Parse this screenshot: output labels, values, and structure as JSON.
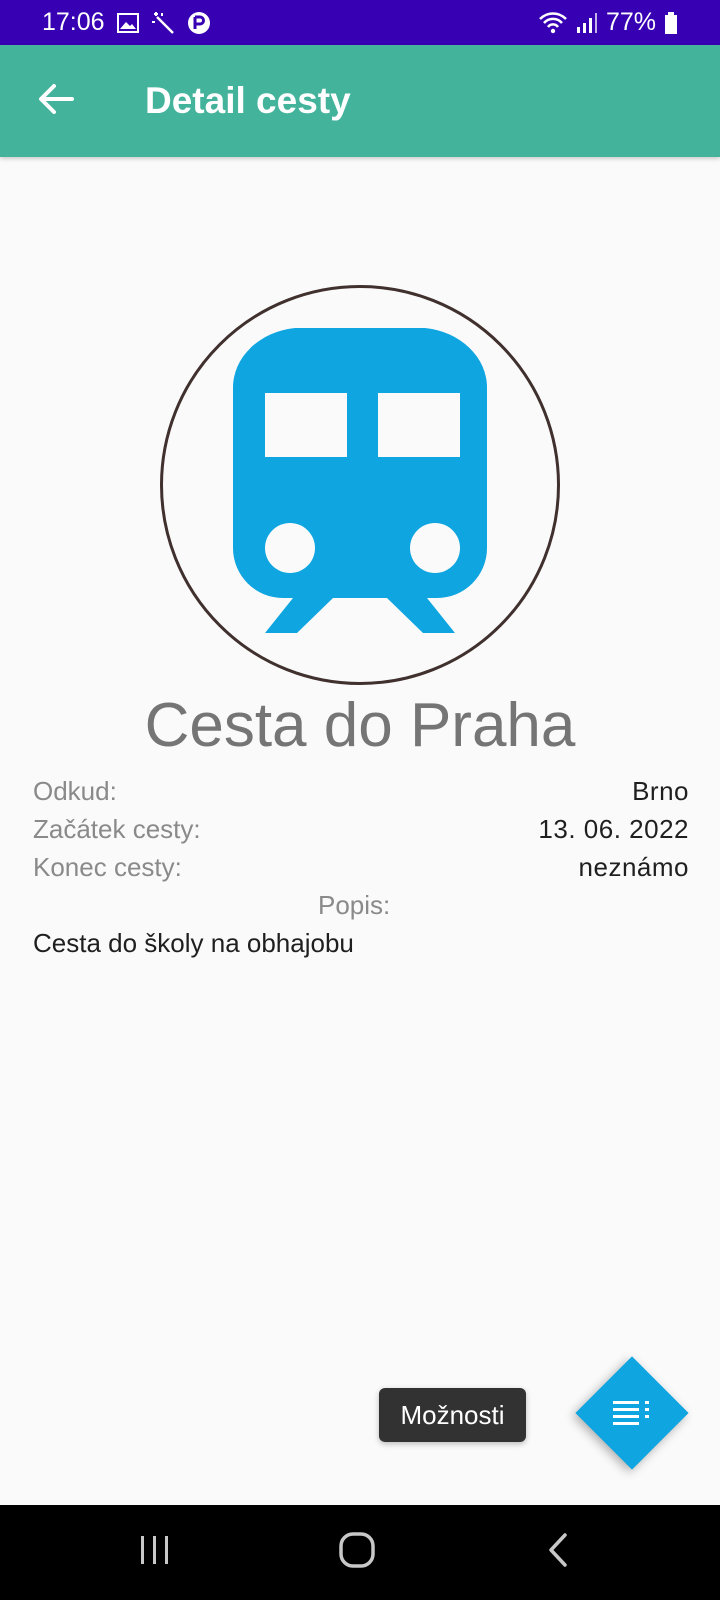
{
  "status_bar": {
    "time": "17:06",
    "battery": "77%",
    "icons": [
      "image-icon",
      "magic-wand-icon",
      "app-notification-icon",
      "wifi-icon",
      "signal-icon",
      "battery-icon"
    ]
  },
  "app_bar": {
    "title": "Detail cesty",
    "back_icon": "arrow-back-icon"
  },
  "trip": {
    "icon": "train-icon",
    "title": "Cesta do Praha",
    "fields": [
      {
        "label": "Odkud:",
        "value": "Brno"
      },
      {
        "label": "Začátek cesty:",
        "value": "13. 06. 2022"
      },
      {
        "label": "Konec cesty:",
        "value": "neznámo"
      }
    ],
    "description_label": "Popis:",
    "description": "Cesta do školy na obhajobu"
  },
  "fab": {
    "tooltip": "Možnosti",
    "icon": "menu-options-icon"
  },
  "colors": {
    "status_bar": "#3700b3",
    "app_bar": "#43b39c",
    "accent": "#0ea5e0",
    "train": "#0ea5e0"
  },
  "nav_bar": {
    "icons": [
      "recent-apps-icon",
      "home-icon",
      "back-nav-icon"
    ]
  }
}
